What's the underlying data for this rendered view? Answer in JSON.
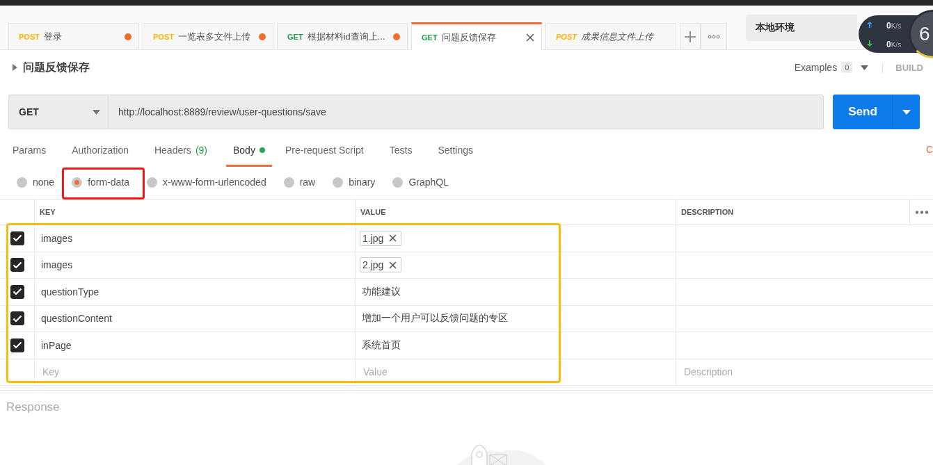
{
  "tabs": [
    {
      "method": "POST",
      "title": "登录",
      "selected": false,
      "unsaved": true,
      "preview": false
    },
    {
      "method": "POST",
      "title": "一览表多文件上传",
      "selected": false,
      "unsaved": true,
      "preview": false
    },
    {
      "method": "GET",
      "title": "根据材料id查询上...",
      "selected": false,
      "unsaved": true,
      "preview": false
    },
    {
      "method": "GET",
      "title": "问题反馈保存",
      "selected": true,
      "preview": false
    },
    {
      "method": "POST",
      "title": "成果信息文件上传",
      "selected": false,
      "unsaved": false,
      "preview": true
    }
  ],
  "environment": "本地环境",
  "net_widget": {
    "up_value": "0",
    "up_unit": "K/s",
    "down_value": "0",
    "down_unit": "K/s",
    "gauge": "6"
  },
  "request": {
    "title": "问题反馈保存",
    "examples_label": "Examples",
    "examples_count": "0",
    "build": "BUILD",
    "method": "GET",
    "url": "http://localhost:8889/review/user-questions/save",
    "send": "Send"
  },
  "request_tabs": [
    {
      "label": "Params",
      "selected": false
    },
    {
      "label": "Authorization",
      "selected": false
    },
    {
      "label": "Headers",
      "count": "(9)",
      "selected": false
    },
    {
      "label": "Body",
      "dot": true,
      "selected": true
    },
    {
      "label": "Pre-request Script",
      "selected": false
    },
    {
      "label": "Tests",
      "selected": false
    },
    {
      "label": "Settings",
      "selected": false
    }
  ],
  "cookies_link": "C",
  "body_modes": [
    {
      "label": "none",
      "selected": false
    },
    {
      "label": "form-data",
      "selected": true
    },
    {
      "label": "x-www-form-urlencoded",
      "selected": false
    },
    {
      "label": "raw",
      "selected": false
    },
    {
      "label": "binary",
      "selected": false
    },
    {
      "label": "GraphQL",
      "selected": false
    }
  ],
  "table": {
    "columns": [
      "KEY",
      "VALUE",
      "DESCRIPTION"
    ],
    "rows": [
      {
        "checked": true,
        "key": "images",
        "kind": "file",
        "value": "1.jpg"
      },
      {
        "checked": true,
        "key": "images",
        "kind": "file",
        "value": "2.jpg"
      },
      {
        "checked": true,
        "key": "questionType",
        "kind": "text",
        "value": "功能建议"
      },
      {
        "checked": true,
        "key": "questionContent",
        "kind": "text",
        "value": "增加一个用户可以反馈问题的专区"
      },
      {
        "checked": true,
        "key": "inPage",
        "kind": "text",
        "value": "系统首页"
      }
    ],
    "new_row": {
      "key_placeholder": "Key",
      "value_placeholder": "Value",
      "description_placeholder": "Description"
    }
  },
  "response": {
    "title": "Response"
  }
}
